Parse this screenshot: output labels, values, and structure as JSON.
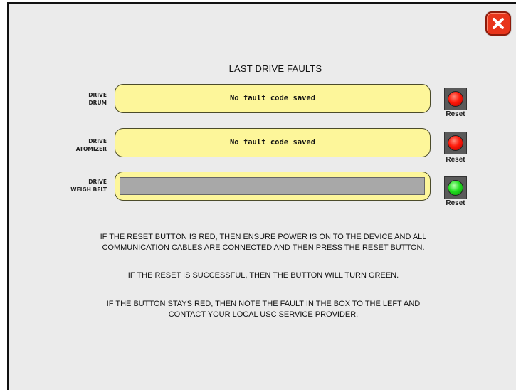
{
  "window": {
    "close_icon": "close-icon"
  },
  "title": "LAST DRIVE FAULTS",
  "drives": [
    {
      "label_line1": "DRIVE",
      "label_line2": "DRUM",
      "fault_text": "No fault code saved",
      "reset_label": "Reset",
      "lamp": "red"
    },
    {
      "label_line1": "DRIVE",
      "label_line2": "ATOMIZER",
      "fault_text": "No fault code saved",
      "reset_label": "Reset",
      "lamp": "red"
    },
    {
      "label_line1": "DRIVE",
      "label_line2": "WEIGH BELT",
      "fault_text": "",
      "reset_label": "Reset",
      "lamp": "green"
    }
  ],
  "instructions": {
    "p1_line1": "IF THE RESET BUTTON IS RED, THEN ENSURE POWER IS ON TO THE DEVICE AND ALL",
    "p1_line2": "COMMUNICATION CABLES ARE CONNECTED AND THEN PRESS THE RESET BUTTON.",
    "p2": "IF THE RESET IS SUCCESSFUL, THEN THE BUTTON WILL TURN GREEN.",
    "p3_line1": "IF THE BUTTON STAYS RED, THEN NOTE THE FAULT IN THE BOX TO THE LEFT AND",
    "p3_line2": "CONTACT YOUR LOCAL USC SERVICE PROVIDER."
  },
  "colors": {
    "lamp_red": "#ff1a0a",
    "lamp_green": "#22e020",
    "fault_box": "#fdf69a",
    "close": "#e8351b"
  }
}
